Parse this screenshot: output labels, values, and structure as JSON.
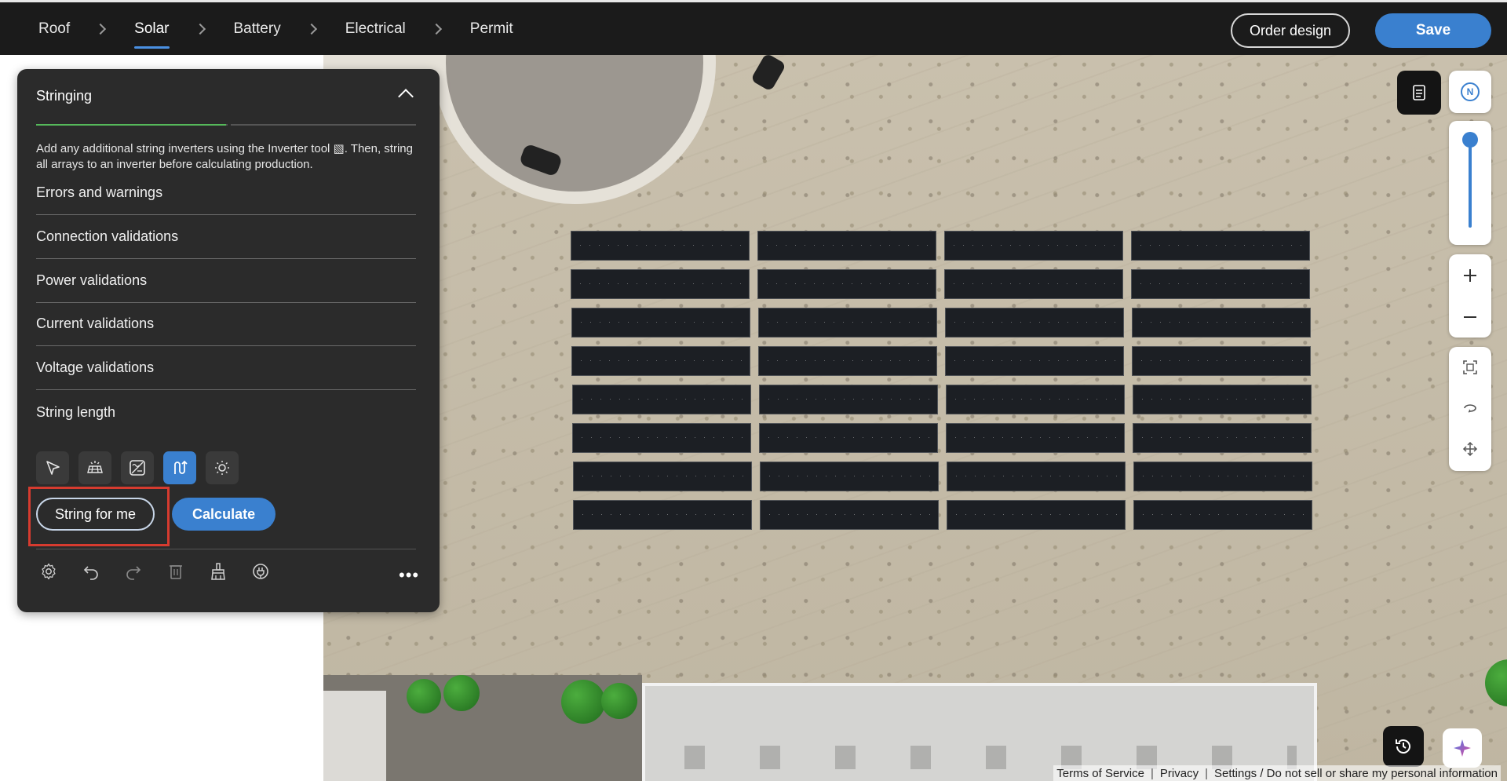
{
  "breadcrumb": {
    "items": [
      {
        "label": "Roof"
      },
      {
        "label": "Solar"
      },
      {
        "label": "Battery"
      },
      {
        "label": "Electrical"
      },
      {
        "label": "Permit"
      }
    ],
    "active_index": 1
  },
  "header": {
    "order_design_label": "Order design",
    "save_label": "Save"
  },
  "panel": {
    "title": "Stringing",
    "progress_fraction": 0.5,
    "description": "Add any additional string inverters using the Inverter tool ▧. Then, string all arrays to an inverter before calculating production.",
    "sections": [
      {
        "label": "Errors and warnings"
      },
      {
        "label": "Connection validations"
      },
      {
        "label": "Power validations"
      },
      {
        "label": "Current validations"
      },
      {
        "label": "Voltage validations"
      },
      {
        "label": "String length"
      }
    ],
    "tools": [
      {
        "icon": "select-arrow-icon"
      },
      {
        "icon": "solar-array-icon"
      },
      {
        "icon": "inverter-icon"
      },
      {
        "icon": "string-wiring-icon",
        "active": true
      },
      {
        "icon": "sun-shading-icon"
      }
    ],
    "string_for_me_label": "String for me",
    "calculate_label": "Calculate",
    "bottom_tools": [
      {
        "icon": "settings-icon"
      },
      {
        "icon": "undo-icon"
      },
      {
        "icon": "redo-icon"
      },
      {
        "icon": "delete-icon"
      },
      {
        "icon": "clean-broom-icon"
      },
      {
        "icon": "power-plug-icon"
      }
    ],
    "more_label": "•••"
  },
  "map": {
    "compass_label": "N"
  },
  "footer": {
    "terms": "Terms of Service",
    "privacy": "Privacy",
    "settings": "Settings / Do not sell or share my personal information"
  },
  "colors": {
    "accent": "#3a80cf",
    "progress": "#55b85a",
    "highlight": "#d63b2f",
    "panel_bg": "#2b2b2b",
    "topbar_bg": "#1b1b1b"
  }
}
